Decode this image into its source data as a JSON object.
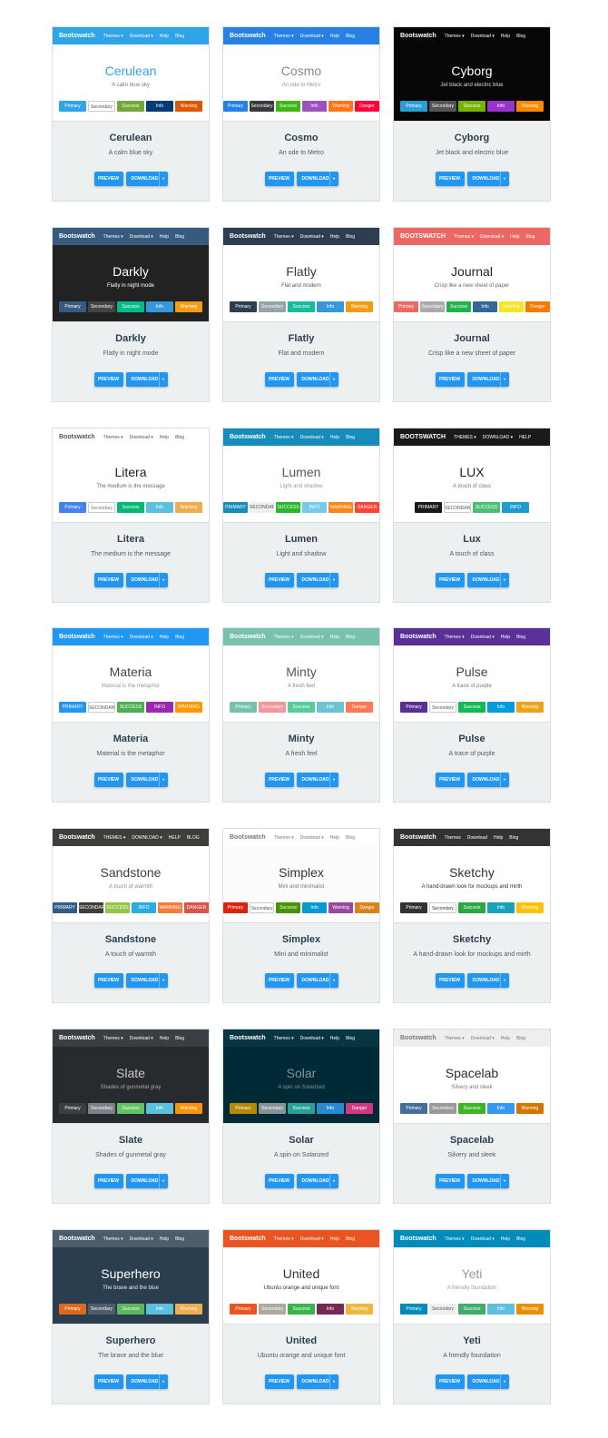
{
  "themes": [
    {
      "name": "Cerulean",
      "desc": "A calm blue sky",
      "nav_bg": "#2fa4e7",
      "nav_fg": "#ffffff",
      "brand": "Bootswatch",
      "items": [
        "Themes ▾",
        "Download ▾",
        "Help",
        "Blog"
      ],
      "body_bg": "#ffffff",
      "title_color": "#2fa4e7",
      "sub_color": "#777777",
      "buttons": [
        {
          "label": "Primary",
          "bg": "#2fa4e7",
          "fg": "#fff"
        },
        {
          "label": "Secondary",
          "bg": "#ffffff",
          "fg": "#555"
        },
        {
          "label": "Success",
          "bg": "#73a839",
          "fg": "#fff"
        },
        {
          "label": "Info",
          "bg": "#033c73",
          "fg": "#fff"
        },
        {
          "label": "Warning",
          "bg": "#dd5600",
          "fg": "#fff"
        }
      ]
    },
    {
      "name": "Cosmo",
      "desc": "An ode to Metro",
      "nav_bg": "#2780e3",
      "nav_fg": "#ffffff",
      "brand": "Bootswatch",
      "items": [
        "Themes ▾",
        "Download ▾",
        "Help",
        "Blog"
      ],
      "body_bg": "#ffffff",
      "title_color": "#888888",
      "sub_color": "#999999",
      "buttons": [
        {
          "label": "Primary",
          "bg": "#2780e3",
          "fg": "#fff"
        },
        {
          "label": "Secondary",
          "bg": "#373a3c",
          "fg": "#fff"
        },
        {
          "label": "Success",
          "bg": "#3fb618",
          "fg": "#fff"
        },
        {
          "label": "Info",
          "bg": "#9954bb",
          "fg": "#fff"
        },
        {
          "label": "Warning",
          "bg": "#ff7518",
          "fg": "#fff"
        },
        {
          "label": "Danger",
          "bg": "#ff0039",
          "fg": "#fff"
        }
      ]
    },
    {
      "name": "Cyborg",
      "desc": "Jet black and electric blue",
      "nav_bg": "#060606",
      "nav_fg": "#ffffff",
      "brand": "Bootswatch",
      "items": [
        "Themes ▾",
        "Download ▾",
        "Help",
        "Blog"
      ],
      "body_bg": "#060606",
      "title_color": "#ffffff",
      "sub_color": "#dddddd",
      "buttons": [
        {
          "label": "Primary",
          "bg": "#2a9fd6",
          "fg": "#fff"
        },
        {
          "label": "Secondary",
          "bg": "#555555",
          "fg": "#fff"
        },
        {
          "label": "Success",
          "bg": "#77b300",
          "fg": "#fff"
        },
        {
          "label": "Info",
          "bg": "#9933cc",
          "fg": "#fff"
        },
        {
          "label": "Warning",
          "bg": "#ff8800",
          "fg": "#fff"
        }
      ]
    },
    {
      "name": "Darkly",
      "desc": "Flatly in night mode",
      "nav_bg": "#375a7f",
      "nav_fg": "#ffffff",
      "brand": "Bootswatch",
      "items": [
        "Themes ▾",
        "Download ▾",
        "Help",
        "Blog"
      ],
      "body_bg": "#222222",
      "title_color": "#ffffff",
      "sub_color": "#ffffff",
      "buttons": [
        {
          "label": "Primary",
          "bg": "#375a7f",
          "fg": "#fff"
        },
        {
          "label": "Secondary",
          "bg": "#444444",
          "fg": "#fff"
        },
        {
          "label": "Success",
          "bg": "#00bc8c",
          "fg": "#fff"
        },
        {
          "label": "Info",
          "bg": "#3498db",
          "fg": "#fff"
        },
        {
          "label": "Warning",
          "bg": "#f39c12",
          "fg": "#fff"
        }
      ]
    },
    {
      "name": "Flatly",
      "desc": "Flat and modern",
      "nav_bg": "#2c3e50",
      "nav_fg": "#ffffff",
      "brand": "Bootswatch",
      "items": [
        "Themes ▾",
        "Download ▾",
        "Help",
        "Blog"
      ],
      "body_bg": "#ffffff",
      "title_color": "#2c3e50",
      "sub_color": "#555555",
      "buttons": [
        {
          "label": "Primary",
          "bg": "#2c3e50",
          "fg": "#fff"
        },
        {
          "label": "Secondary",
          "bg": "#95a5a6",
          "fg": "#fff"
        },
        {
          "label": "Success",
          "bg": "#18bc9c",
          "fg": "#fff"
        },
        {
          "label": "Info",
          "bg": "#3498db",
          "fg": "#fff"
        },
        {
          "label": "Warning",
          "bg": "#f39c12",
          "fg": "#fff"
        }
      ]
    },
    {
      "name": "Journal",
      "desc": "Crisp like a new sheet of paper",
      "nav_bg": "#eb6864",
      "nav_fg": "#ffffff",
      "brand": "BOOTSWATCH",
      "items": [
        "Themes ▾",
        "Download ▾",
        "Help",
        "Blog"
      ],
      "body_bg": "#ffffff",
      "title_color": "#222222",
      "sub_color": "#666666",
      "buttons": [
        {
          "label": "Primary",
          "bg": "#eb6864",
          "fg": "#fff"
        },
        {
          "label": "Secondary",
          "bg": "#aaaaaa",
          "fg": "#fff"
        },
        {
          "label": "Success",
          "bg": "#22b24c",
          "fg": "#fff"
        },
        {
          "label": "Info",
          "bg": "#336699",
          "fg": "#fff"
        },
        {
          "label": "Warning",
          "bg": "#f5e625",
          "fg": "#fff"
        },
        {
          "label": "Danger",
          "bg": "#f57a00",
          "fg": "#fff"
        }
      ]
    },
    {
      "name": "Litera",
      "desc": "The medium is the message",
      "nav_bg": "#ffffff",
      "nav_fg": "#555555",
      "brand": "Bootswatch",
      "items": [
        "Themes ▾",
        "Download ▾",
        "Help",
        "Blog"
      ],
      "body_bg": "#ffffff",
      "title_color": "#222222",
      "sub_color": "#666666",
      "buttons": [
        {
          "label": "Primary",
          "bg": "#4582ec",
          "fg": "#fff"
        },
        {
          "label": "Secondary",
          "bg": "#ffffff",
          "fg": "#777"
        },
        {
          "label": "Success",
          "bg": "#02b875",
          "fg": "#fff"
        },
        {
          "label": "Info",
          "bg": "#5bc0de",
          "fg": "#fff"
        },
        {
          "label": "Warning",
          "bg": "#f0ad4e",
          "fg": "#fff"
        }
      ]
    },
    {
      "name": "Lumen",
      "desc": "Light and shadow",
      "nav_bg": "#158cba",
      "nav_fg": "#ffffff",
      "brand": "Bootswatch",
      "items": [
        "Themes ▾",
        "Download ▾",
        "Help",
        "Blog"
      ],
      "body_bg": "#ffffff",
      "title_color": "#555555",
      "sub_color": "#999999",
      "buttons": [
        {
          "label": "PRIMARY",
          "bg": "#158cba",
          "fg": "#fff"
        },
        {
          "label": "SECONDARY",
          "bg": "#f0f0f0",
          "fg": "#555"
        },
        {
          "label": "SUCCESS",
          "bg": "#28b62c",
          "fg": "#fff"
        },
        {
          "label": "INFO",
          "bg": "#75caeb",
          "fg": "#fff"
        },
        {
          "label": "WARNING",
          "bg": "#ff851b",
          "fg": "#fff"
        },
        {
          "label": "DANGER",
          "bg": "#ff4136",
          "fg": "#fff"
        }
      ]
    },
    {
      "name": "LUX",
      "desc": "A touch of class",
      "nav_bg": "#1a1a1a",
      "nav_fg": "#ffffff",
      "brand": "BOOTSWATCH",
      "items": [
        "THEMES ▾",
        "DOWNLOAD ▾",
        "HELP"
      ],
      "body_bg": "#ffffff",
      "title_color": "#1a1a1a",
      "sub_color": "#777777",
      "buttons": [
        {
          "label": "PRIMARY",
          "bg": "#1a1a1a",
          "fg": "#fff"
        },
        {
          "label": "SECONDARY",
          "bg": "#ffffff",
          "fg": "#555"
        },
        {
          "label": "SUCCESS",
          "bg": "#4bbf73",
          "fg": "#fff"
        },
        {
          "label": "INFO",
          "bg": "#1f9bcf",
          "fg": "#fff"
        }
      ]
    },
    {
      "name": "Materia",
      "desc": "Material is the metaphor",
      "nav_bg": "#2196f3",
      "nav_fg": "#ffffff",
      "brand": "Bootswatch",
      "items": [
        "Themes ▾",
        "Download ▾",
        "Help",
        "Blog"
      ],
      "body_bg": "#ffffff",
      "title_color": "#444444",
      "sub_color": "#999999",
      "buttons": [
        {
          "label": "PRIMARY",
          "bg": "#2196f3",
          "fg": "#fff"
        },
        {
          "label": "SECONDARY",
          "bg": "#ffffff",
          "fg": "#555"
        },
        {
          "label": "SUCCESS",
          "bg": "#4caf50",
          "fg": "#fff"
        },
        {
          "label": "INFO",
          "bg": "#9c27b0",
          "fg": "#fff"
        },
        {
          "label": "WARNING",
          "bg": "#ff9800",
          "fg": "#fff"
        }
      ]
    },
    {
      "name": "Minty",
      "desc": "A fresh feel",
      "nav_bg": "#78c2ad",
      "nav_fg": "#ffffff",
      "brand": "Bootswatch",
      "items": [
        "Themes ▾",
        "Download ▾",
        "Help",
        "Blog"
      ],
      "body_bg": "#ffffff",
      "title_color": "#555555",
      "sub_color": "#888888",
      "buttons": [
        {
          "label": "Primary",
          "bg": "#78c2ad",
          "fg": "#fff"
        },
        {
          "label": "Secondary",
          "bg": "#f3969a",
          "fg": "#fff"
        },
        {
          "label": "Success",
          "bg": "#56cc9d",
          "fg": "#fff"
        },
        {
          "label": "Info",
          "bg": "#6cc3d5",
          "fg": "#fff"
        },
        {
          "label": "Danger",
          "bg": "#ff7851",
          "fg": "#fff"
        }
      ]
    },
    {
      "name": "Pulse",
      "desc": "A trace of purple",
      "nav_bg": "#593196",
      "nav_fg": "#ffffff",
      "brand": "Bootswatch",
      "items": [
        "Themes ▾",
        "Download ▾",
        "Help",
        "Blog"
      ],
      "body_bg": "#ffffff",
      "title_color": "#444444",
      "sub_color": "#777777",
      "buttons": [
        {
          "label": "Primary",
          "bg": "#593196",
          "fg": "#fff"
        },
        {
          "label": "Secondary",
          "bg": "#ffffff",
          "fg": "#555"
        },
        {
          "label": "Success",
          "bg": "#13b955",
          "fg": "#fff"
        },
        {
          "label": "Info",
          "bg": "#009cdc",
          "fg": "#fff"
        },
        {
          "label": "Warning",
          "bg": "#efa31d",
          "fg": "#fff"
        }
      ]
    },
    {
      "name": "Sandstone",
      "desc": "A touch of warmth",
      "nav_bg": "#3e3f3a",
      "nav_fg": "#ffffff",
      "brand": "Bootswatch",
      "items": [
        "THEMES ▾",
        "DOWNLOAD ▾",
        "HELP",
        "BLOG"
      ],
      "body_bg": "#ffffff",
      "title_color": "#3e3f3a",
      "sub_color": "#8e8c84",
      "buttons": [
        {
          "label": "PRIMARY",
          "bg": "#325d88",
          "fg": "#fff"
        },
        {
          "label": "SECONDARY",
          "bg": "#3e3f3a",
          "fg": "#fff"
        },
        {
          "label": "SUCCESS",
          "bg": "#93c54b",
          "fg": "#fff"
        },
        {
          "label": "INFO",
          "bg": "#29abe0",
          "fg": "#fff"
        },
        {
          "label": "WARNING",
          "bg": "#f47c3c",
          "fg": "#fff"
        },
        {
          "label": "DANGER",
          "bg": "#d9534f",
          "fg": "#fff"
        }
      ]
    },
    {
      "name": "Simplex",
      "desc": "Mini and minimalist",
      "nav_bg": "#ffffff",
      "nav_fg": "#777777",
      "brand": "Bootswatch",
      "items": [
        "Themes ▾",
        "Download ▾",
        "Help",
        "Blog"
      ],
      "body_bg": "#fcfcfc",
      "title_color": "#333333",
      "sub_color": "#777777",
      "buttons": [
        {
          "label": "Primary",
          "bg": "#d9230f",
          "fg": "#fff"
        },
        {
          "label": "Secondary",
          "bg": "#ffffff",
          "fg": "#555"
        },
        {
          "label": "Success",
          "bg": "#469408",
          "fg": "#fff"
        },
        {
          "label": "Info",
          "bg": "#029acf",
          "fg": "#fff"
        },
        {
          "label": "Warning",
          "bg": "#9b479f",
          "fg": "#fff"
        },
        {
          "label": "Danger",
          "bg": "#d9831f",
          "fg": "#fff"
        }
      ]
    },
    {
      "name": "Sketchy",
      "desc": "A hand-drawn look for mockups and mirth",
      "nav_bg": "#333333",
      "nav_fg": "#ffffff",
      "brand": "Bootswatch",
      "items": [
        "Themes",
        "Download",
        "Help",
        "Blog"
      ],
      "body_bg": "#ffffff",
      "title_color": "#333333",
      "sub_color": "#333333",
      "buttons": [
        {
          "label": "Primary",
          "bg": "#333333",
          "fg": "#fff"
        },
        {
          "label": "Secondary",
          "bg": "#ffffff",
          "fg": "#333"
        },
        {
          "label": "Success",
          "bg": "#28a745",
          "fg": "#fff"
        },
        {
          "label": "Info",
          "bg": "#17a2b8",
          "fg": "#fff"
        },
        {
          "label": "Warning",
          "bg": "#ffc107",
          "fg": "#fff"
        }
      ]
    },
    {
      "name": "Slate",
      "desc": "Shades of gunmetal gray",
      "nav_bg": "#3a3f44",
      "nav_fg": "#ffffff",
      "brand": "Bootswatch",
      "items": [
        "Themes ▾",
        "Download ▾",
        "Help",
        "Blog"
      ],
      "body_bg": "#272b30",
      "title_color": "#c8c8c8",
      "sub_color": "#aaaaaa",
      "buttons": [
        {
          "label": "Primary",
          "bg": "#3a3f44",
          "fg": "#fff"
        },
        {
          "label": "Secondary",
          "bg": "#7a8288",
          "fg": "#fff"
        },
        {
          "label": "Success",
          "bg": "#62c462",
          "fg": "#fff"
        },
        {
          "label": "Info",
          "bg": "#5bc0de",
          "fg": "#fff"
        },
        {
          "label": "Warning",
          "bg": "#f89406",
          "fg": "#fff"
        }
      ]
    },
    {
      "name": "Solar",
      "desc": "A spin on Solarized",
      "nav_bg": "#073642",
      "nav_fg": "#ffffff",
      "brand": "Bootswatch",
      "items": [
        "Themes ▾",
        "Download ▾",
        "Help",
        "Blog"
      ],
      "body_bg": "#002b36",
      "title_color": "#839496",
      "sub_color": "#839496",
      "buttons": [
        {
          "label": "Primary",
          "bg": "#b58900",
          "fg": "#fff"
        },
        {
          "label": "Secondary",
          "bg": "#839496",
          "fg": "#fff"
        },
        {
          "label": "Success",
          "bg": "#2aa198",
          "fg": "#fff"
        },
        {
          "label": "Info",
          "bg": "#268bd2",
          "fg": "#fff"
        },
        {
          "label": "Danger",
          "bg": "#d33682",
          "fg": "#fff"
        }
      ]
    },
    {
      "name": "Spacelab",
      "desc": "Silvery and sleek",
      "nav_bg": "#eeeeee",
      "nav_fg": "#777777",
      "brand": "Bootswatch",
      "items": [
        "Themes ▾",
        "Download ▾",
        "Help",
        "Blog"
      ],
      "body_bg": "#ffffff",
      "title_color": "#2d2d2d",
      "sub_color": "#777777",
      "buttons": [
        {
          "label": "Primary",
          "bg": "#446e9b",
          "fg": "#fff"
        },
        {
          "label": "Secondary",
          "bg": "#999999",
          "fg": "#fff"
        },
        {
          "label": "Success",
          "bg": "#3cb521",
          "fg": "#fff"
        },
        {
          "label": "Info",
          "bg": "#3399f3",
          "fg": "#fff"
        },
        {
          "label": "Warning",
          "bg": "#d47500",
          "fg": "#fff"
        }
      ]
    },
    {
      "name": "Superhero",
      "desc": "The brave and the blue",
      "nav_bg": "#4e5d6c",
      "nav_fg": "#ffffff",
      "brand": "Bootswatch",
      "items": [
        "Themes ▾",
        "Download ▾",
        "Help",
        "Blog"
      ],
      "body_bg": "#2b3e50",
      "title_color": "#ffffff",
      "sub_color": "#ebebeb",
      "buttons": [
        {
          "label": "Primary",
          "bg": "#df691a",
          "fg": "#fff"
        },
        {
          "label": "Secondary",
          "bg": "#4e5d6c",
          "fg": "#fff"
        },
        {
          "label": "Success",
          "bg": "#5cb85c",
          "fg": "#fff"
        },
        {
          "label": "Info",
          "bg": "#5bc0de",
          "fg": "#fff"
        },
        {
          "label": "Warning",
          "bg": "#f0ad4e",
          "fg": "#fff"
        }
      ]
    },
    {
      "name": "United",
      "desc": "Ubuntu orange and unique font",
      "nav_bg": "#e95420",
      "nav_fg": "#ffffff",
      "brand": "Bootswatch",
      "items": [
        "Themes ▾",
        "Download ▾",
        "Help",
        "Blog"
      ],
      "body_bg": "#ffffff",
      "title_color": "#333333",
      "sub_color": "#333333",
      "buttons": [
        {
          "label": "Primary",
          "bg": "#e95420",
          "fg": "#fff"
        },
        {
          "label": "Secondary",
          "bg": "#aea79f",
          "fg": "#fff"
        },
        {
          "label": "Success",
          "bg": "#38b44a",
          "fg": "#fff"
        },
        {
          "label": "Info",
          "bg": "#772953",
          "fg": "#fff"
        },
        {
          "label": "Warning",
          "bg": "#efb73e",
          "fg": "#fff"
        }
      ]
    },
    {
      "name": "Yeti",
      "desc": "A friendly foundation",
      "nav_bg": "#008cba",
      "nav_fg": "#ffffff",
      "brand": "Bootswatch",
      "items": [
        "Themes ▾",
        "Download ▾",
        "Help",
        "Blog"
      ],
      "body_bg": "#ffffff",
      "title_color": "#999999",
      "sub_color": "#999999",
      "buttons": [
        {
          "label": "Primary",
          "bg": "#008cba",
          "fg": "#fff"
        },
        {
          "label": "Secondary",
          "bg": "#eeeeee",
          "fg": "#555"
        },
        {
          "label": "Success",
          "bg": "#43ac6a",
          "fg": "#fff"
        },
        {
          "label": "Info",
          "bg": "#5bc0de",
          "fg": "#fff"
        },
        {
          "label": "Warning",
          "bg": "#e99002",
          "fg": "#fff"
        }
      ]
    }
  ],
  "card_titles": [
    "Cerulean",
    "Cosmo",
    "Cyborg",
    "Darkly",
    "Flatly",
    "Journal",
    "Litera",
    "Lumen",
    "Lux",
    "Materia",
    "Minty",
    "Pulse",
    "Sandstone",
    "Simplex",
    "Sketchy",
    "Slate",
    "Solar",
    "Spacelab",
    "Superhero",
    "United",
    "Yeti"
  ],
  "actions": {
    "preview": "PREVIEW",
    "download": "DOWNLOAD",
    "caret": "▾"
  },
  "accent": "#2196f3"
}
